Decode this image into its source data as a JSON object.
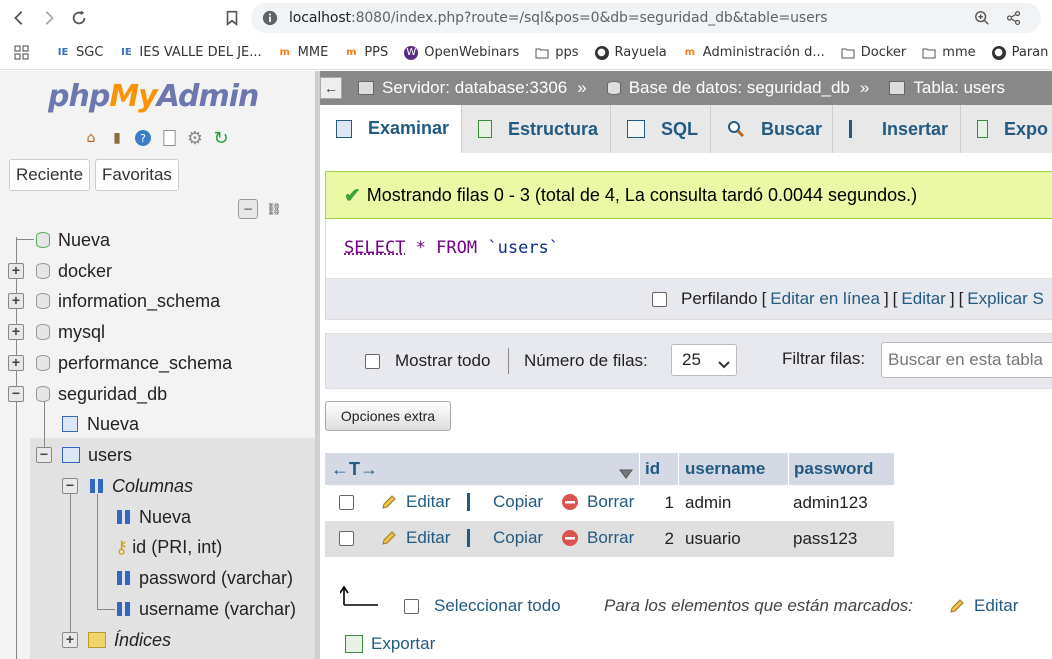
{
  "browser": {
    "url_host": "localhost",
    "url_rest": ":8080/index.php?route=/sql&pos=0&db=seguridad_db&table=users",
    "bookmarks": [
      "SGC",
      "IES VALLE DEL JE...",
      "MME",
      "PPS",
      "OpenWebinars",
      "pps",
      "Rayuela",
      "Administración d...",
      "Docker",
      "mme",
      "Paran"
    ]
  },
  "nav": {
    "logo_php": "php",
    "logo_my": "My",
    "logo_admin": "Admin",
    "recent_tab": "Reciente",
    "favorites_tab": "Favoritas",
    "tree": {
      "new": "Nueva",
      "databases": [
        "docker",
        "information_schema",
        "mysql",
        "performance_schema",
        "seguridad_db"
      ],
      "db_new": "Nueva",
      "table": "users",
      "columns_label": "Columnas",
      "col_new": "Nueva",
      "columns": [
        "id (PRI, int)",
        "password (varchar)",
        "username (varchar)"
      ],
      "indexes_label": "Índices"
    }
  },
  "breadcrumb": {
    "server": "Servidor: database:3306",
    "database": "Base de datos: seguridad_db",
    "table": "Tabla: users",
    "sep": "»"
  },
  "tabs": [
    "Examinar",
    "Estructura",
    "SQL",
    "Buscar",
    "Insertar",
    "Expo"
  ],
  "message": "Mostrando filas 0 - 3 (total de 4, La consulta tardó 0.0044 segundos.)",
  "sql": {
    "select": "SELECT",
    "star": "*",
    "from": "FROM",
    "table": "`users`"
  },
  "profiling": {
    "label": "Perfilando",
    "bracket_open": "[",
    "bracket_close": "]",
    "edit_inline": "Editar en línea",
    "edit": "Editar",
    "explain": "Explicar S"
  },
  "filters": {
    "show_all": "Mostrar todo",
    "rows_label": "Número de filas:",
    "rows_value": "25",
    "filter_label": "Filtrar filas:",
    "filter_placeholder": "Buscar en esta tabla"
  },
  "extra_options": "Opciones extra",
  "table": {
    "columns": [
      "id",
      "username",
      "password"
    ],
    "actions": {
      "edit": "Editar",
      "copy": "Copiar",
      "delete": "Borrar"
    },
    "rows": [
      {
        "id": "1",
        "username": "admin",
        "password": "admin123"
      },
      {
        "id": "2",
        "username": "usuario",
        "password": "pass123"
      }
    ]
  },
  "footer": {
    "select_all": "Seleccionar todo",
    "marked_label": "Para los elementos que están marcados:",
    "edit": "Editar",
    "export": "Exportar"
  },
  "colors": {
    "link": "#235a81",
    "success_bg": "#ebf8a4",
    "header_bar": "#888888"
  }
}
